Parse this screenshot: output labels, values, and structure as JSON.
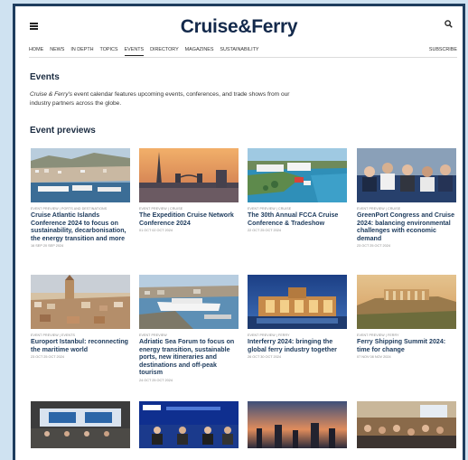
{
  "header": {
    "logo": "Cruise&Ferry"
  },
  "nav": {
    "items": [
      "HOME",
      "NEWS",
      "IN DEPTH",
      "TOPICS",
      "EVENTS",
      "DIRECTORY",
      "MAGAZINES",
      "SUSTAINABILITY"
    ],
    "active": "EVENTS",
    "subscribe": "SUBSCRIBE"
  },
  "events": {
    "heading": "Events",
    "intro_italic": "Cruise & Ferry's",
    "intro_rest": " event calendar features upcoming events, conferences, and trade shows from our industry partners across the globe."
  },
  "previews": {
    "heading": "Event previews",
    "cards": [
      {
        "category": "EVENT PREVIEW | PORTS AND DESTINATIONS",
        "title": "Cruise Atlantic Islands Conference 2024 to focus on sustainability, decarbonisation, the energy transition and more",
        "date": "16 SEP 20 SEP 2024"
      },
      {
        "category": "EVENT PREVIEW | CRUISE",
        "title": "The Expedition Cruise Network Conference 2024",
        "date": "01 OCT 02 OCT 2024"
      },
      {
        "category": "EVENT PREVIEW | CRUISE",
        "title": "The 30th Annual FCCA Cruise Conference & Tradeshow",
        "date": "22 OCT 25 OCT 2024"
      },
      {
        "category": "EVENT PREVIEW | CRUISE",
        "title": "GreenPort Congress and Cruise 2024: balancing environmental challenges with economic demand",
        "date": "23 OCT 25 OCT 2024"
      },
      {
        "category": "EVENT PREVIEW | EVENTS",
        "title": "Europort Istanbul: reconnecting the maritime world",
        "date": "23 OCT 25 OCT 2024"
      },
      {
        "category": "EVENT PREVIEW",
        "title": "Adriatic Sea Forum to focus on energy transition, sustainable ports, new itineraries and destinations and off-peak tourism",
        "date": "24 OCT 25 OCT 2024"
      },
      {
        "category": "EVENT PREVIEW | FERRY",
        "title": "Interferry 2024: bringing the global ferry industry together",
        "date": "26 OCT 30 OCT 2024"
      },
      {
        "category": "EVENT PREVIEW | FERRY",
        "title": "Ferry Shipping Summit 2024: time for change",
        "date": "07 NOV 08 NOV 2024"
      }
    ]
  },
  "icons": {
    "menu": "hamburger-menu-icon",
    "search": "search-icon"
  },
  "colors": {
    "frame": "#1f3d5e",
    "background": "#cfe2f1",
    "logo": "#13294b",
    "title": "#1c3a5c"
  }
}
